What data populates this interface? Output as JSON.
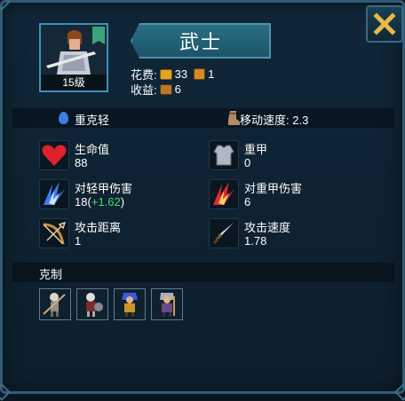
{
  "unit": {
    "name": "武士",
    "level": "15级"
  },
  "cost": {
    "label": "花费:",
    "gold": "33",
    "supply": "1"
  },
  "income": {
    "label": "收益:",
    "value": "6"
  },
  "armor_class": {
    "label": "重克轻"
  },
  "move_speed": {
    "label": "移动速度: 2.3"
  },
  "stats": {
    "hp": {
      "label": "生命值",
      "value": "88"
    },
    "armor": {
      "label": "重甲",
      "value": "0"
    },
    "dmg_light": {
      "label": "对轻甲伤害",
      "value": "18",
      "bonus": "+1.62",
      "open": "(",
      "close": ")"
    },
    "dmg_heavy": {
      "label": "对重甲伤害",
      "value": "6"
    },
    "range": {
      "label": "攻击距离",
      "value": "1"
    },
    "atk_speed": {
      "label": "攻击速度",
      "value": "1.78"
    }
  },
  "counter": {
    "label": "克制",
    "units": [
      "skeleton-spearman",
      "skeleton-warrior",
      "blue-haired-rogue",
      "grey-haired-mage"
    ]
  },
  "colors": {
    "panel_border": "#2f5c73",
    "nameplate": "#2a6f84",
    "bonus_green": "#3fe06a",
    "close_x": "#e9b84a"
  }
}
